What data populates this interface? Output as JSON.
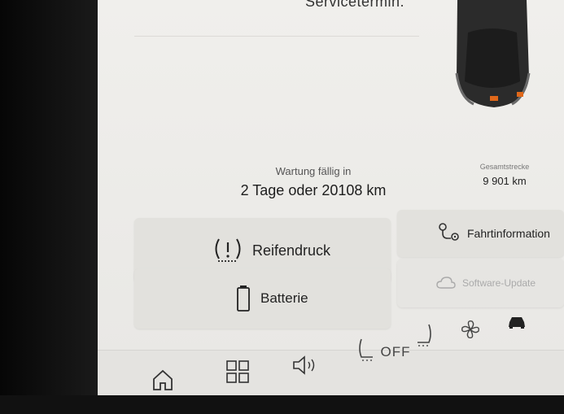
{
  "top_text": "Servicetermin.",
  "maintenance": {
    "label": "Wartung fällig in",
    "value": "2 Tage oder 20108 km"
  },
  "odometer": {
    "label": "Gesamtstrecke",
    "value": "9 901 km"
  },
  "tiles": {
    "tire": {
      "label": "Reifendruck",
      "icon": "tire-pressure-warning-icon"
    },
    "battery": {
      "label": "Batterie",
      "icon": "battery-icon"
    },
    "drive_info": {
      "label": "Fahrtinformation",
      "icon": "route-icon"
    },
    "software": {
      "label": "Software-Update",
      "icon": "cloud-icon"
    }
  },
  "bottom_bar": {
    "home_icon": "home-icon",
    "apps_icon": "grid-icon",
    "volume_icon": "speaker-icon",
    "seat_heat_label": "OFF",
    "fan_icon": "fan-icon",
    "car_icon": "car-icon"
  },
  "colors": {
    "screen_bg": "#ecebe8",
    "tile_bg": "#e2e1dd",
    "text": "#222222",
    "car_accent": "#e0681a"
  }
}
